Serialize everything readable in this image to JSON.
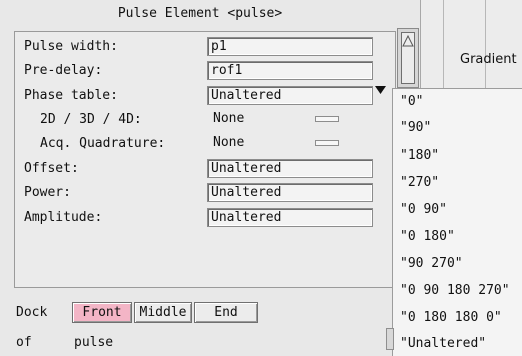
{
  "window": {
    "title": "Pulse Element <pulse>"
  },
  "fields": {
    "pulse_width": {
      "label": "Pulse width:",
      "value": "p1"
    },
    "pre_delay": {
      "label": "Pre-delay:",
      "value": "rof1"
    },
    "phase_table": {
      "label": "Phase table:",
      "value": "Unaltered"
    },
    "dim": {
      "label": "2D / 3D / 4D:",
      "value": "None"
    },
    "acq_quadrature": {
      "label": "Acq. Quadrature:",
      "value": "None"
    },
    "offset": {
      "label": "Offset:",
      "value": "Unaltered"
    },
    "power": {
      "label": "Power:",
      "value": "Unaltered"
    },
    "amplitude": {
      "label": "Amplitude:",
      "value": "Unaltered"
    }
  },
  "background_panel": {
    "gradient_label": "Gradient"
  },
  "phase_menu": {
    "options": [
      "\"0\"",
      "\"90\"",
      "\"180\"",
      "\"270\"",
      "\"0 90\"",
      "\"0 180\"",
      "\"90 270\"",
      "\"0 90 180 270\"",
      "\"0 180 180 0\"",
      "\"Unaltered\""
    ]
  },
  "dock": {
    "label": "Dock",
    "buttons": [
      "Front",
      "Middle",
      "End"
    ],
    "selected": "Front"
  },
  "footer": {
    "of_label": "of",
    "pulse_label": "pulse"
  },
  "colors": {
    "active_button": "#f3b5c6"
  }
}
